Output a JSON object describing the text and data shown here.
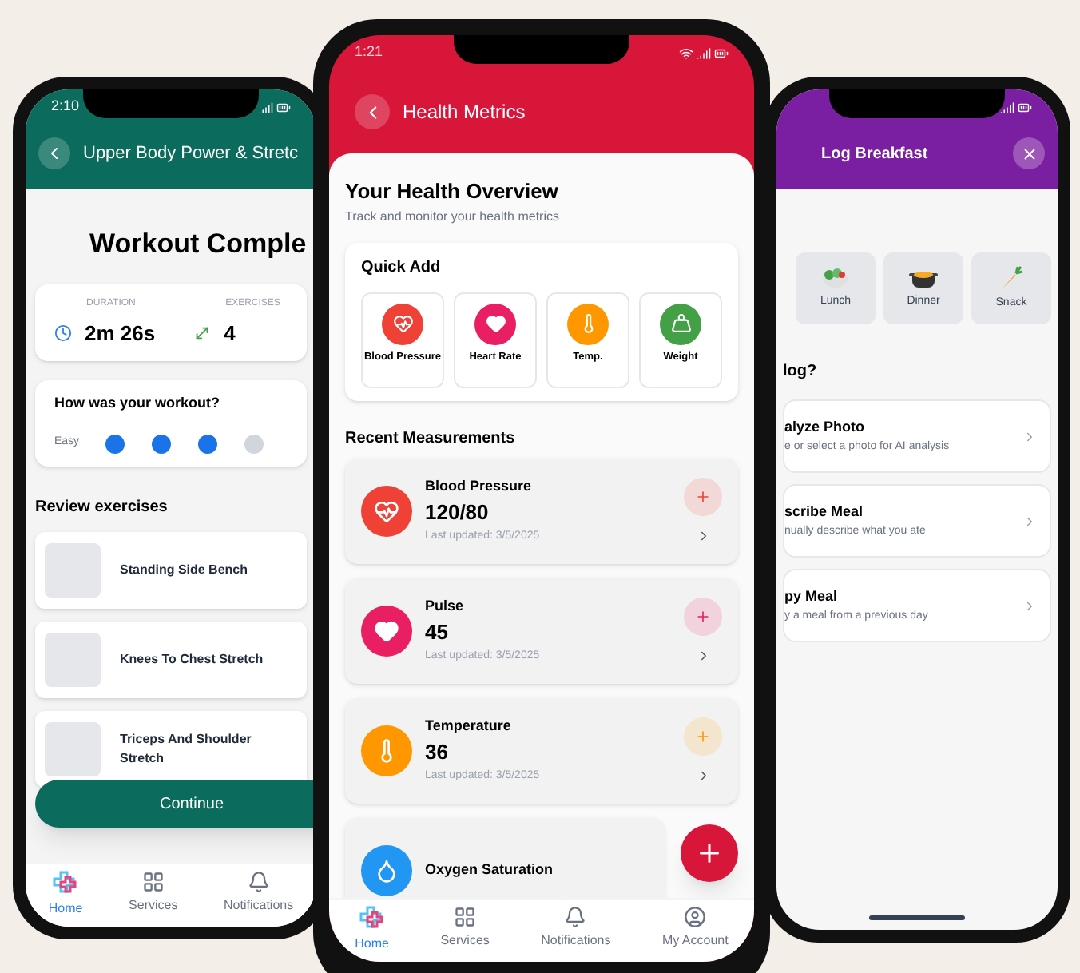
{
  "left_phone": {
    "status_time": "2:10",
    "header_title": "Upper Body Power & Stretc",
    "heading": "Workout Comple",
    "stats": [
      {
        "kind": "duration",
        "label": "DURATION",
        "value": "2m 26s"
      },
      {
        "kind": "exercises",
        "label": "EXERCISES",
        "value": "4"
      }
    ],
    "rating": {
      "question": "How was your workout?",
      "label": "Easy",
      "stars": 3
    },
    "section_title": "Review exercises",
    "exercises": [
      "Standing Side Bench",
      "Knees To Chest Stretch",
      "Triceps And Shoulder Stretch"
    ],
    "continue_button": "Continue",
    "nav": [
      {
        "kind": "home",
        "label": "Home",
        "selected": true
      },
      {
        "kind": "services",
        "label": "Services",
        "selected": false
      },
      {
        "kind": "notifications",
        "label": "Notifications",
        "selected": false
      }
    ]
  },
  "center_phone": {
    "status_time": "1:21",
    "title": "Health Metrics",
    "overview_title": "Your Health Overview",
    "overview_subtitle": "Track and monitor your health metrics",
    "quick_add": {
      "title": "Quick Add",
      "items": [
        {
          "kind": "blood_pressure",
          "label": "Blood Pressure",
          "color": "#ef4136"
        },
        {
          "kind": "heart",
          "label": "Heart Rate",
          "color": "#e91e63"
        },
        {
          "kind": "temperature",
          "label": "Temp.",
          "color": "#ff9800"
        },
        {
          "kind": "weight",
          "label": "Weight",
          "color": "#43a047"
        }
      ]
    },
    "recent_title": "Recent Measurements",
    "measurements": [
      {
        "kind": "blood_pressure",
        "name": "Blood Pressure",
        "value": "120/80",
        "updated": "Last updated: 3/5/2025",
        "color": "#ef4136"
      },
      {
        "kind": "heart",
        "name": "Pulse",
        "value": "45",
        "updated": "Last updated: 3/5/2025",
        "color": "#e91e63"
      },
      {
        "kind": "temperature",
        "name": "Temperature",
        "value": "36",
        "updated": "Last updated: 3/5/2025",
        "color": "#ff9800"
      },
      {
        "kind": "oxygen",
        "name": "Oxygen Saturation",
        "color": "#2196f3"
      }
    ],
    "nav": [
      {
        "kind": "home",
        "label": "Home",
        "selected": true
      },
      {
        "kind": "services",
        "label": "Services",
        "selected": false
      },
      {
        "kind": "notifications",
        "label": "Notifications",
        "selected": false
      },
      {
        "kind": "account",
        "label": "My Account",
        "selected": false
      }
    ]
  },
  "right_phone": {
    "title": "Log Breakfast",
    "meals": [
      {
        "kind": "salad",
        "label": "Lunch"
      },
      {
        "kind": "pot",
        "label": "Dinner"
      },
      {
        "kind": "carrot",
        "label": "Snack"
      }
    ],
    "question": "log?",
    "options": [
      {
        "title": "alyze Photo",
        "subtitle": "e or select a photo for AI analysis"
      },
      {
        "title": "scribe Meal",
        "subtitle": "nually describe what you ate"
      },
      {
        "title": "py Meal",
        "subtitle": "y a meal from a previous day"
      }
    ]
  }
}
